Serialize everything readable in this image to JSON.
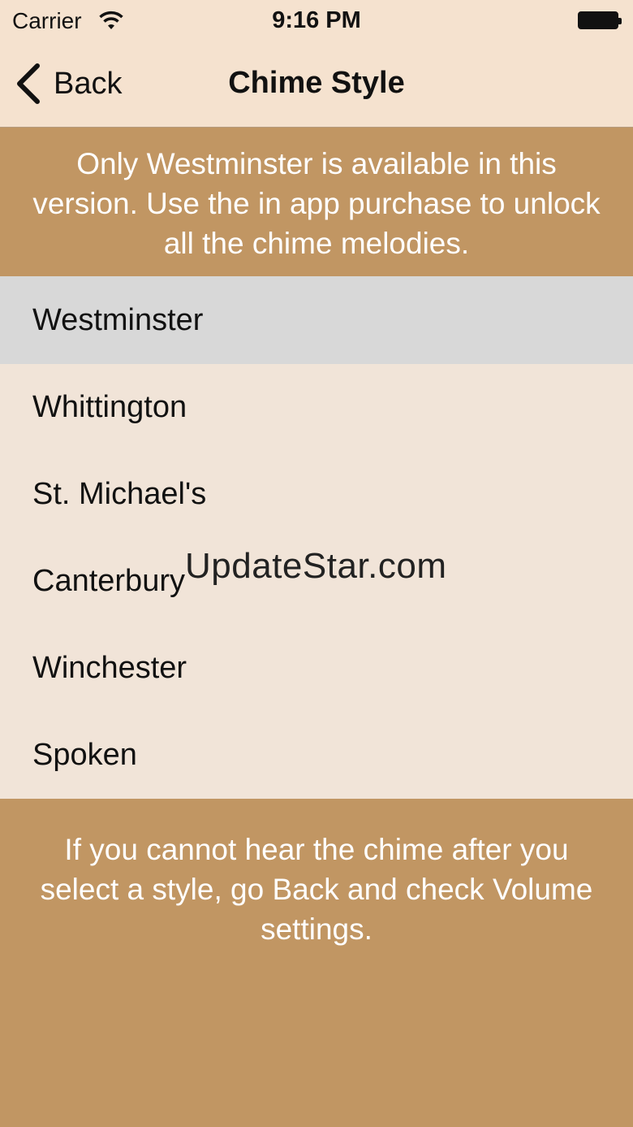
{
  "status_bar": {
    "carrier": "Carrier",
    "time": "9:16 PM",
    "wifi_icon": "wifi-icon",
    "battery_icon": "battery-full-icon"
  },
  "nav": {
    "back_label": "Back",
    "back_icon": "chevron-left-icon",
    "title": "Chime Style"
  },
  "notice_top": "Only Westminster is available in this version. Use the in app purchase to unlock all the chime melodies.",
  "chime_styles": {
    "selected": "Westminster",
    "items": [
      {
        "label": "Westminster"
      },
      {
        "label": "Whittington"
      },
      {
        "label": "St. Michael's"
      },
      {
        "label": "Canterbury"
      },
      {
        "label": "Winchester"
      },
      {
        "label": "Spoken"
      }
    ]
  },
  "watermark": "UpdateStar.com",
  "notice_bottom": "If you cannot hear the chime after you select a style, go Back and check Volume settings.",
  "colors": {
    "bar_background": "#f5e2cf",
    "accent_tan": "#c19663",
    "list_background": "#f1e4d8",
    "selected_row": "#d8d8d8"
  }
}
